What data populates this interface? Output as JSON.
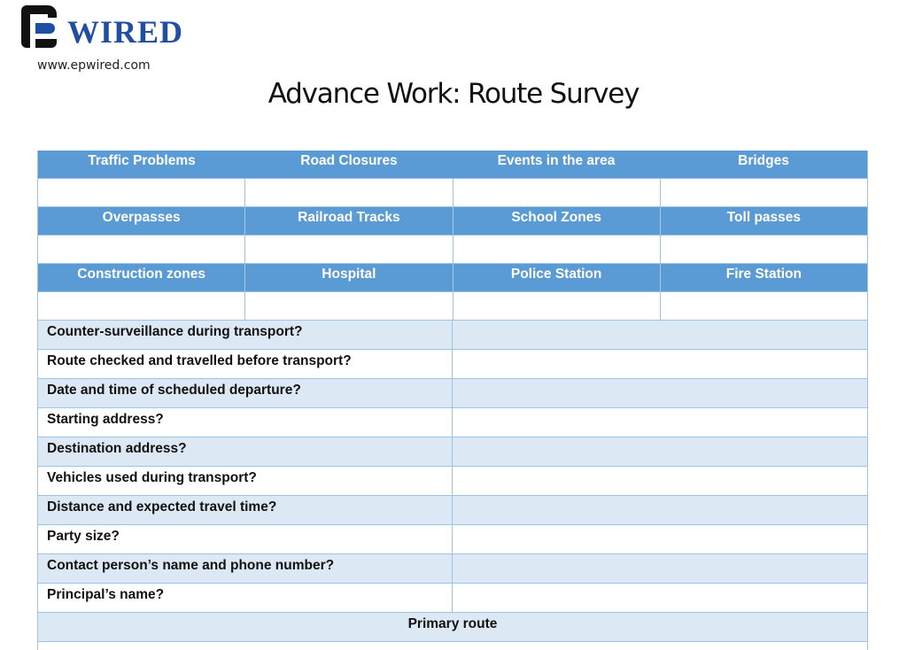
{
  "brand": {
    "logo_word": "WIRED",
    "website": "www.epwired.com",
    "colors": {
      "brand_blue": "#1f4ea3",
      "mark_black": "#111111"
    }
  },
  "document": {
    "title": "Advance Work: Route Survey"
  },
  "colors": {
    "header_fill": "#5b9bd5",
    "shaded_row": "#dde8f5",
    "border": "#9cc2e5"
  },
  "grid": {
    "header_rows": [
      {
        "labels": [
          "Traffic Problems",
          "Road Closures",
          "Events in the area",
          "Bridges"
        ],
        "values": [
          "",
          "",
          "",
          ""
        ]
      },
      {
        "labels": [
          "Overpasses",
          "Railroad Tracks",
          "School Zones",
          "Toll passes"
        ],
        "values": [
          "",
          "",
          "",
          ""
        ]
      },
      {
        "labels": [
          "Construction zones",
          "Hospital",
          "Police Station",
          "Fire Station"
        ],
        "values": [
          "",
          "",
          "",
          ""
        ]
      }
    ]
  },
  "questions": [
    {
      "label": "Counter-surveillance during transport?",
      "answer": ""
    },
    {
      "label": "Route checked and travelled before transport?",
      "answer": ""
    },
    {
      "label": "Date and time of scheduled departure?",
      "answer": ""
    },
    {
      "label": "Starting address?",
      "answer": ""
    },
    {
      "label": "Destination address?",
      "answer": ""
    },
    {
      "label": "Vehicles used during transport?",
      "answer": ""
    },
    {
      "label": "Distance and expected travel time?",
      "answer": ""
    },
    {
      "label": "Party size?",
      "answer": ""
    },
    {
      "label": "Contact person’s name and phone number?",
      "answer": ""
    },
    {
      "label": "Principal’s name?",
      "answer": ""
    }
  ],
  "sections": {
    "primary_route": "Primary route"
  }
}
